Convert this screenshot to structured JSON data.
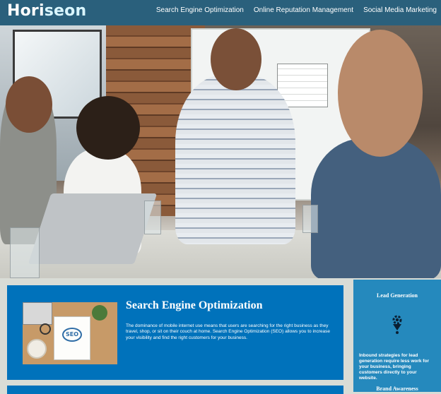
{
  "header": {
    "logo_main": "Hori",
    "logo_accent": "seon",
    "nav": [
      {
        "label": "Search Engine Optimization"
      },
      {
        "label": "Online Reputation Management"
      },
      {
        "label": "Social Media Marketing"
      }
    ]
  },
  "hero": {
    "image_description": "team-meeting-photo"
  },
  "main": {
    "cards": [
      {
        "title": "Search Engine Optimization",
        "image_badge": "SEO",
        "text": "The dominance of mobile internet use means that users are searching for the right business as they travel, shop, or sit on their couch at home. Search Engine Optimization (SEO) allows you to increase your visibility and find the right customers for your business."
      }
    ]
  },
  "sidebar": {
    "items": [
      {
        "title": "Lead Generation",
        "text": "Inbound strategies for lead generation require less work for your business, bringing customers directly to your website."
      },
      {
        "title": "Brand Awareness",
        "text": ""
      }
    ]
  },
  "colors": {
    "header_bg": "#2a607c",
    "content_bg": "#0072bb",
    "sidebar_bg": "#2589bd",
    "page_bg": "#d9dcd6"
  }
}
